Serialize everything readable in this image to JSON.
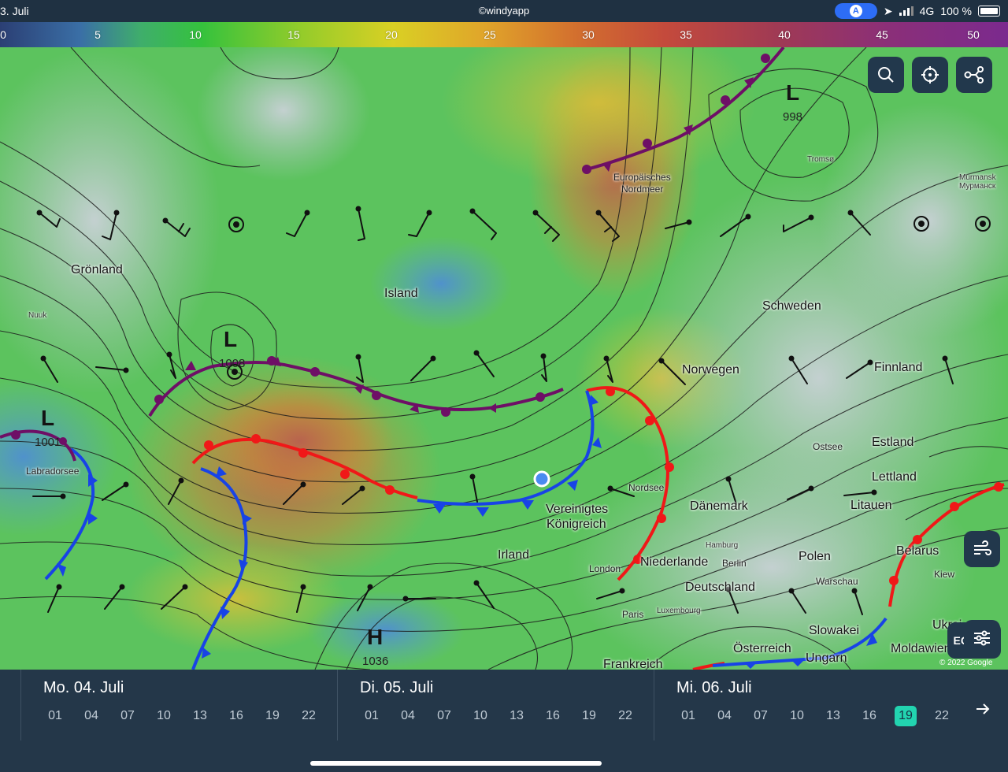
{
  "status": {
    "date": "3. Juli",
    "watermark": "©windyapp",
    "signal": "4G",
    "battery": "100 %"
  },
  "scale": {
    "labels": [
      "0",
      "5",
      "10",
      "15",
      "20",
      "25",
      "30",
      "35",
      "40",
      "45",
      "50"
    ]
  },
  "map": {
    "labels": {
      "gronland": "Grönland",
      "island": "Island",
      "europaisches": "Europäisches",
      "nordmeer": "Nordmeer",
      "schweden": "Schweden",
      "norwegen": "Norwegen",
      "finnland": "Finnland",
      "estland": "Estland",
      "lettland": "Lettland",
      "litauen": "Litauen",
      "ostsee": "Ostsee",
      "nordsee": "Nordsee",
      "danemark": "Dänemark",
      "vereinigtes": "Vereinigtes",
      "konigreich": "Königreich",
      "irland": "Irland",
      "london": "London",
      "niederlande": "Niederlande",
      "berlin": "Berlin",
      "polen": "Polen",
      "warschau": "Warschau",
      "deutschland": "Deutschland",
      "belarus": "Belarus",
      "paris": "Paris",
      "frankreich": "Frankreich",
      "osterreich": "Österreich",
      "slowakei": "Slowakei",
      "ungarn": "Ungarn",
      "moldawien": "Moldawien",
      "ukraine": "Ukrai",
      "kiew": "Kiew",
      "labradorsee": "Labradorsee",
      "google": "© 2022 Google",
      "tromso": "Tromsø",
      "murmansk": "Murmansk\nМурманск",
      "nuuk": "Nuuk",
      "luxembourg": "Luxembourg",
      "hamburg": "Hamburg"
    },
    "systems": [
      {
        "letter": "L",
        "pressure": "998"
      },
      {
        "letter": "L",
        "pressure": "1001"
      },
      {
        "letter": "L",
        "pressure": "1008"
      },
      {
        "letter": "H",
        "pressure": "1036"
      }
    ],
    "buttons": {
      "model": "ECMWF"
    }
  },
  "timeline": {
    "days": [
      {
        "title": "Mo. 04. Juli",
        "hours": [
          "01",
          "04",
          "07",
          "10",
          "13",
          "16",
          "19",
          "22"
        ]
      },
      {
        "title": "Di. 05. Juli",
        "hours": [
          "01",
          "04",
          "07",
          "10",
          "13",
          "16",
          "19",
          "22"
        ]
      },
      {
        "title": "Mi. 06. Juli",
        "hours": [
          "01",
          "04",
          "07",
          "10",
          "13",
          "16",
          "19",
          "22"
        ],
        "selected": "19"
      }
    ]
  }
}
